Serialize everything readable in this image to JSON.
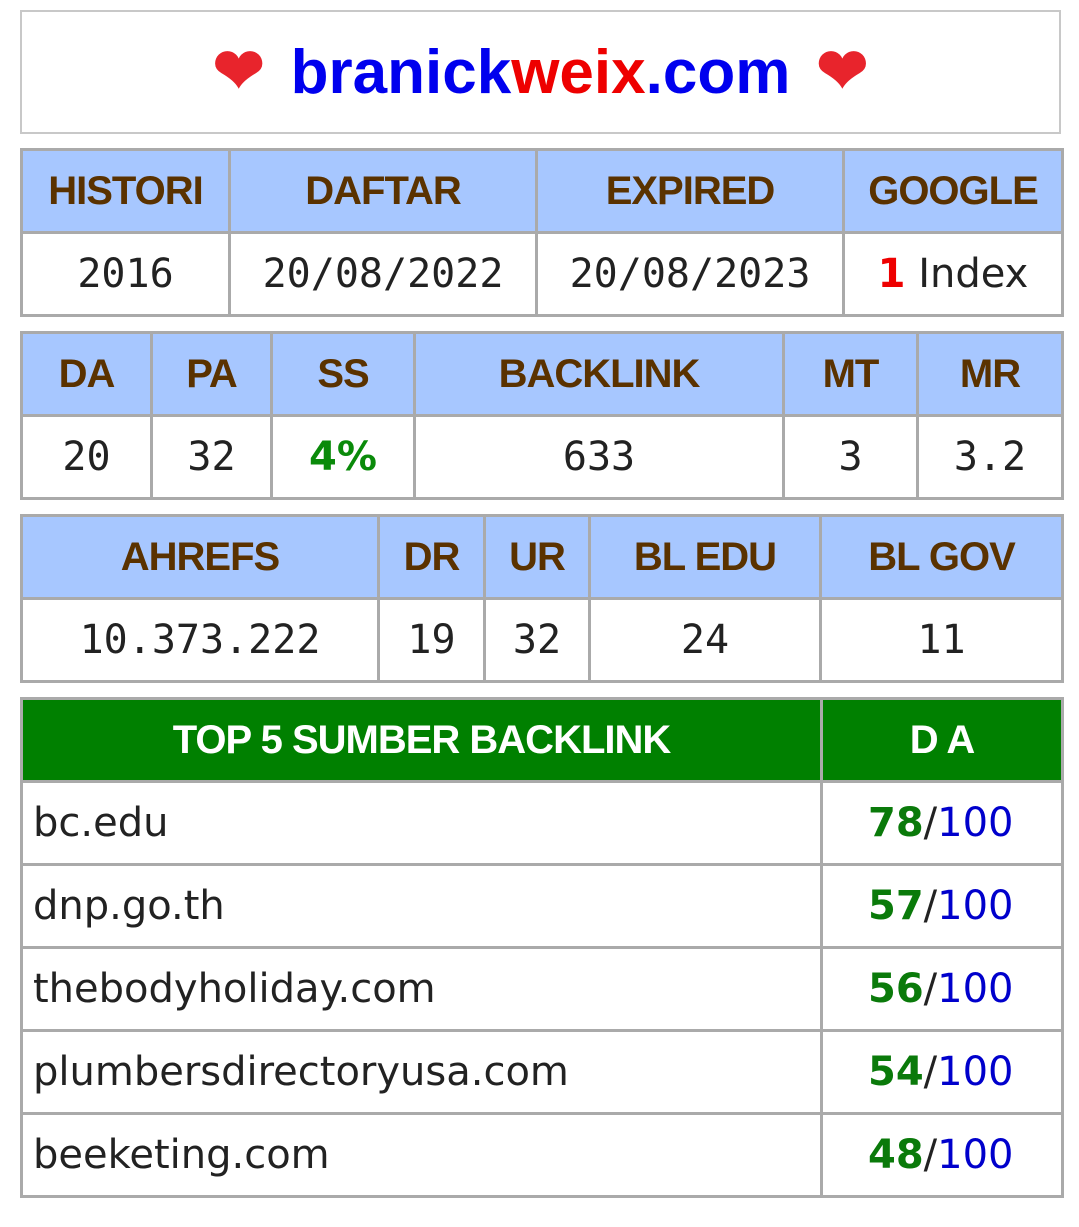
{
  "title": {
    "part1": "branick",
    "part2": "weix",
    "part3": ".com",
    "heart_icon": "heart-icon"
  },
  "info": {
    "headers": [
      "HISTORI",
      "DAFTAR",
      "EXPIRED",
      "GOOGLE"
    ],
    "values": {
      "histori": "2016",
      "daftar": "20/08/2022",
      "expired": "20/08/2023",
      "google_num": "1",
      "google_word": " Index"
    }
  },
  "moz": {
    "headers": [
      "DA",
      "PA",
      "SS",
      "BACKLINK",
      "MT",
      "MR"
    ],
    "values": [
      "20",
      "32",
      "4%",
      "633",
      "3",
      "3.2"
    ]
  },
  "ahrefs": {
    "headers": [
      "AHREFS",
      "DR",
      "UR",
      "BL EDU",
      "BL GOV"
    ],
    "values": [
      "10.373.222",
      "19",
      "32",
      "24",
      "11"
    ]
  },
  "top5": {
    "header_left": "TOP 5 SUMBER BACKLINK",
    "header_right": "D A",
    "rows": [
      {
        "site": "bc.edu",
        "da": "78",
        "max": "100"
      },
      {
        "site": "dnp.go.th",
        "da": "57",
        "max": "100"
      },
      {
        "site": "thebodyholiday.com",
        "da": "56",
        "max": "100"
      },
      {
        "site": "plumbersdirectoryusa.com",
        "da": "54",
        "max": "100"
      },
      {
        "site": "beeketing.com",
        "da": "48",
        "max": "100"
      }
    ],
    "slash": "/"
  },
  "colors": {
    "header_bg": "#a7c7ff",
    "header_text": "#5a3200",
    "green_header": "#008000",
    "accent_red": "#ee0000",
    "accent_blue": "#0000ee"
  }
}
